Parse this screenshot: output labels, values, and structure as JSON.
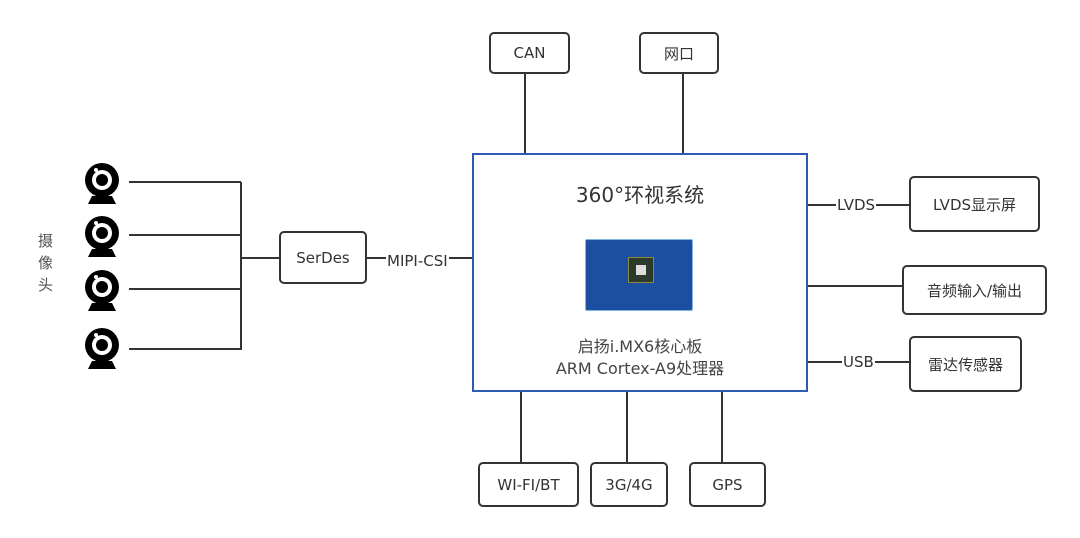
{
  "central": {
    "title": "360°环视系统",
    "board_line1": "启扬i.MX6核心板",
    "board_line2": "ARM Cortex-A9处理器",
    "border_color": "#2a5db0"
  },
  "top_boxes": [
    "CAN",
    "网口"
  ],
  "right": {
    "lvds_label": "LVDS",
    "lvds_box": "LVDS显示屏",
    "audio_box": "音频输入/输出",
    "usb_label": "USB",
    "radar_box": "雷达传感器"
  },
  "bottom_boxes": [
    "WI-FI/BT",
    "3G/4G",
    "GPS"
  ],
  "left": {
    "camera_label": "摄像头",
    "camera_count": 4,
    "serdes_box": "SerDes",
    "mipi_label": "MIPI-CSI",
    "camera_icon": "webcam-icon"
  }
}
